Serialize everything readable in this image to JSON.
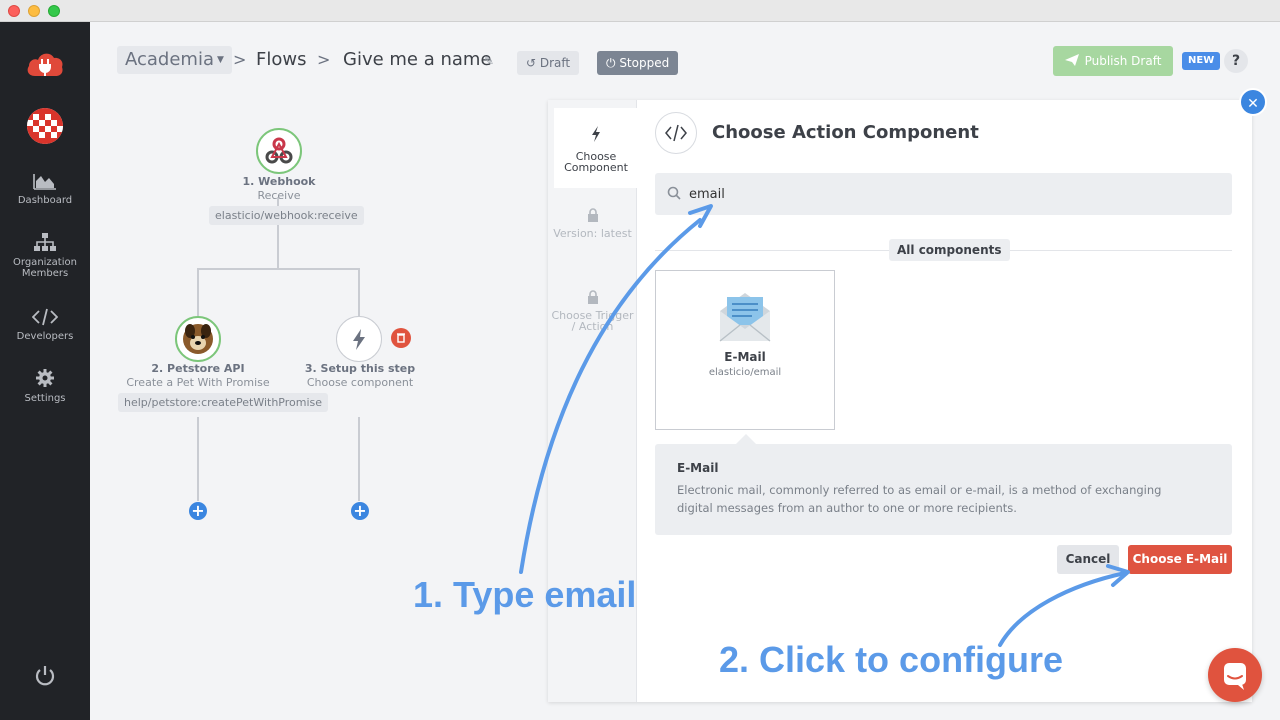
{
  "header": {
    "org": "Academia",
    "crumb_flows": "Flows",
    "flow_name": "Give me a name",
    "draft_label": "Draft",
    "status_label": "Stopped",
    "publish_label": "Publish Draft",
    "new_badge": "NEW",
    "help": "?"
  },
  "sidebar": {
    "items": [
      {
        "label": "Dashboard",
        "icon": "chart-area-icon"
      },
      {
        "label": "Organization Members",
        "icon": "sitemap-icon"
      },
      {
        "label": "Developers",
        "icon": "code-icon"
      },
      {
        "label": "Settings",
        "icon": "gear-icon"
      }
    ]
  },
  "flow": {
    "nodes": [
      {
        "title": "1. Webhook",
        "subtitle": "Receive",
        "tag": "elasticio/webhook:receive"
      },
      {
        "title": "2. Petstore API",
        "subtitle": "Create a Pet With Promise",
        "tag": "help/petstore:createPetWithPromise"
      },
      {
        "title": "3. Setup this step",
        "subtitle": "Choose component"
      }
    ]
  },
  "panel": {
    "steps": [
      {
        "label": "Choose Component"
      },
      {
        "label": "Version: latest"
      },
      {
        "label": "Choose Trigger / Action"
      }
    ],
    "title": "Choose Action Component",
    "search_value": "email",
    "section_label": "All components",
    "component": {
      "name": "E-Mail",
      "id": "elasticio/email"
    },
    "description": {
      "title": "E-Mail",
      "text": "Electronic mail, commonly referred to as email or e-mail, is a method of exchanging digital messages from an author to one or more recipients."
    },
    "cancel_label": "Cancel",
    "choose_label": "Choose E-Mail"
  },
  "annotations": {
    "step1": "1. Type email",
    "step2": "2. Click to configure"
  },
  "colors": {
    "accent_blue": "#3b86e0",
    "danger_red": "#df5441",
    "annotation_blue": "#5b9ae8",
    "sidebar_bg": "#212327"
  }
}
